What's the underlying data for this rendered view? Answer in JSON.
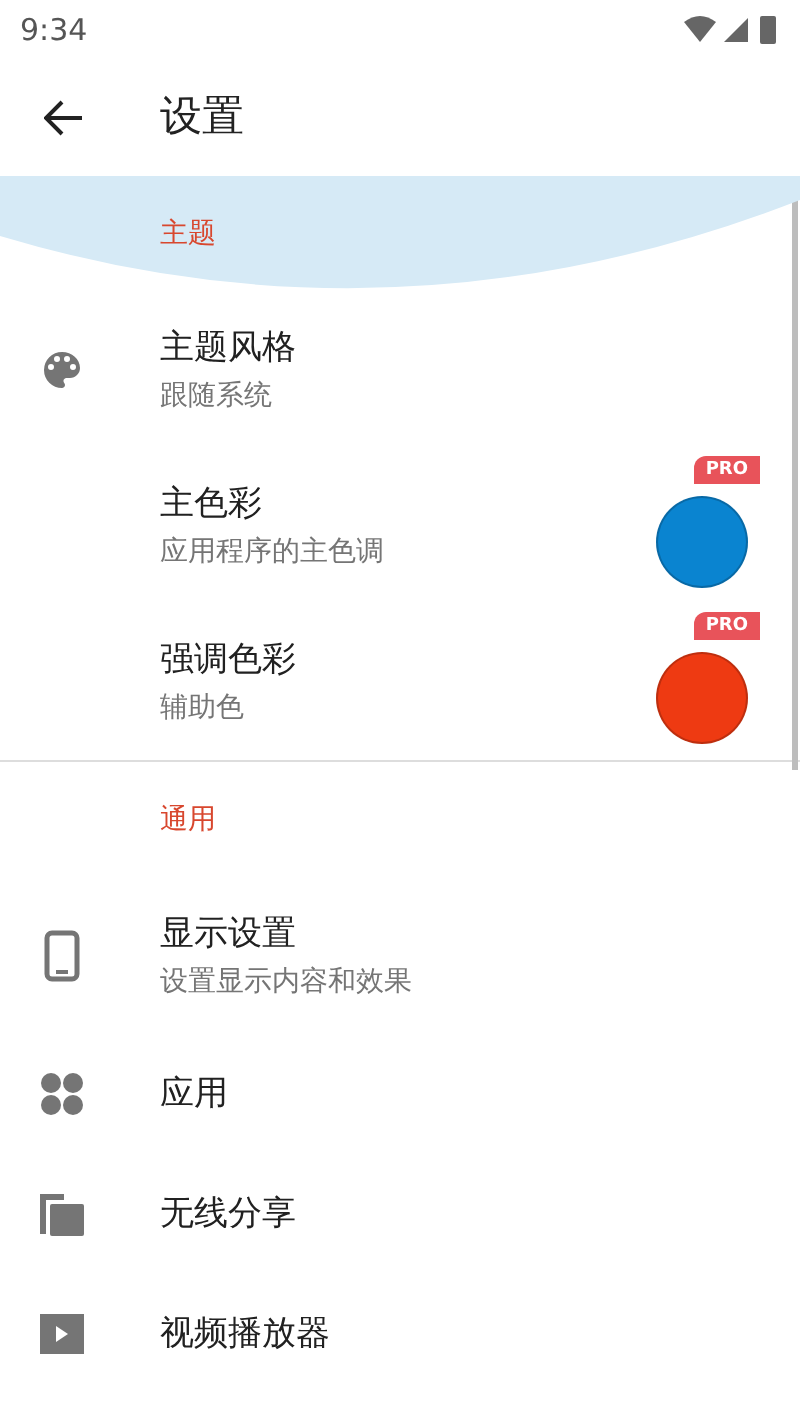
{
  "status_bar": {
    "time": "9:34"
  },
  "app_bar": {
    "title": "设置"
  },
  "sections": [
    {
      "title": "主题",
      "banner": true,
      "items": [
        {
          "kind": "plain",
          "title": "主题风格",
          "subtitle": "跟随系统"
        },
        {
          "kind": "color",
          "title": "主色彩",
          "subtitle": "应用程序的主色调",
          "color": "#0a84d0",
          "badge": "PRO"
        },
        {
          "kind": "color",
          "title": "强调色彩",
          "subtitle": "辅助色",
          "color": "#ee3a12",
          "badge": "PRO"
        }
      ]
    },
    {
      "title": "通用",
      "banner": false,
      "items": [
        {
          "kind": "plain",
          "title": "显示设置",
          "subtitle": "设置显示内容和效果"
        },
        {
          "kind": "plain",
          "title": "应用"
        },
        {
          "kind": "plain",
          "title": "无线分享"
        },
        {
          "kind": "plain",
          "title": "视频播放器"
        }
      ]
    }
  ]
}
